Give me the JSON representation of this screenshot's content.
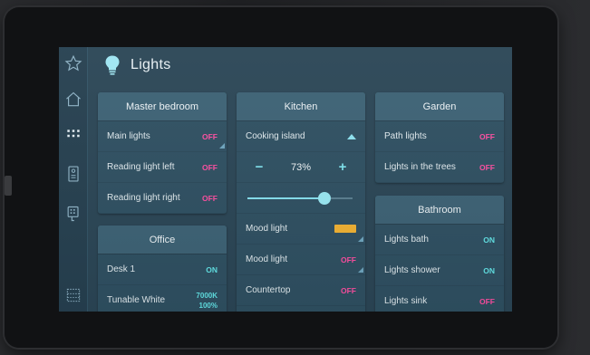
{
  "header": {
    "title": "Lights"
  },
  "sidebar": {
    "items": [
      {
        "icon": "star-icon"
      },
      {
        "icon": "home-icon"
      },
      {
        "icon": "grid-icon"
      },
      {
        "icon": "intercom-icon"
      },
      {
        "icon": "keypad-icon"
      },
      {
        "icon": "building-icon"
      }
    ]
  },
  "rooms": {
    "master_bedroom": {
      "title": "Master bedroom",
      "rows": [
        {
          "label": "Main lights",
          "value": "OFF"
        },
        {
          "label": "Reading light left",
          "value": "OFF"
        },
        {
          "label": "Reading light right",
          "value": "OFF"
        }
      ]
    },
    "office": {
      "title": "Office",
      "rows": [
        {
          "label": "Desk 1",
          "value": "ON"
        },
        {
          "label": "Tunable White",
          "value": "7000K",
          "value2": "100%"
        }
      ]
    },
    "kitchen": {
      "title": "Kitchen",
      "cooking_island": {
        "label": "Cooking island",
        "level": "73%",
        "minus": "−",
        "plus": "+",
        "slider_fraction": 0.73
      },
      "rows": [
        {
          "label": "Mood light",
          "value": "",
          "color": "#f2b233"
        },
        {
          "label": "Mood light",
          "value": "OFF"
        },
        {
          "label": "Countertop",
          "value": "OFF"
        }
      ]
    },
    "garden": {
      "title": "Garden",
      "rows": [
        {
          "label": "Path lights",
          "value": "OFF"
        },
        {
          "label": "Lights in the trees",
          "value": "OFF"
        }
      ]
    },
    "bathroom": {
      "title": "Bathroom",
      "rows": [
        {
          "label": "Lights bath",
          "value": "ON"
        },
        {
          "label": "Lights shower",
          "value": "ON"
        },
        {
          "label": "Lights sink",
          "value": "OFF"
        }
      ]
    }
  },
  "colors": {
    "on": "#62e3e6",
    "off": "#ff4fa2",
    "accent": "#86e0ef"
  }
}
